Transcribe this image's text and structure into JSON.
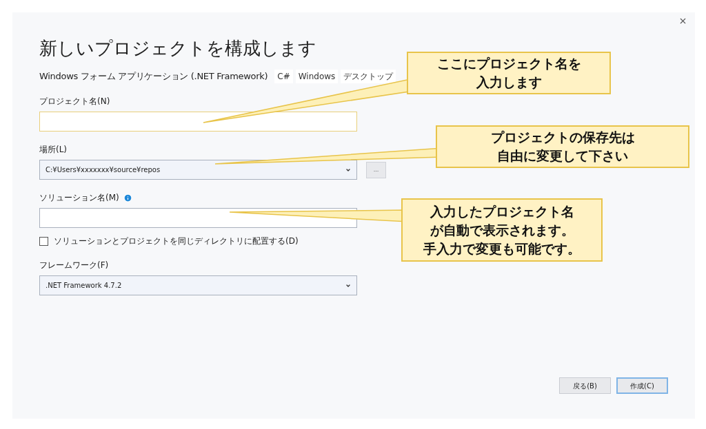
{
  "dialog": {
    "title": "新しいプロジェクトを構成します",
    "template": "Windows フォーム アプリケーション (.NET Framework)",
    "tags": [
      "C#",
      "Windows",
      "デスクトップ"
    ]
  },
  "fields": [
    {
      "kind": "text",
      "label": "プロジェクト名(N)",
      "focused": true,
      "info": false
    },
    {
      "kind": "dropdown",
      "label": "場所(L)",
      "value": "C:¥Users¥xxxxxxx¥source¥repos",
      "focused": false,
      "info": false,
      "browse": "..."
    },
    {
      "kind": "text",
      "label": "ソリューション名(M)",
      "focused": false,
      "info": true
    },
    {
      "kind": "checkbox",
      "label": "ソリューションとプロジェクトを同じディレクトリに配置する(D)",
      "checked": false
    },
    {
      "kind": "dropdown",
      "label": "フレームワーク(F)",
      "value": ".NET Framework 4.7.2",
      "focused": false,
      "info": false
    }
  ],
  "buttons": [
    {
      "label": "戻る(B)",
      "default": false
    },
    {
      "label": "作成(C)",
      "default": true
    }
  ],
  "callouts": [
    {
      "lines": [
        "ここにプロジェクト名を",
        "入力します"
      ]
    },
    {
      "lines": [
        "プロジェクトの保存先は",
        "自由に変更して下さい"
      ]
    },
    {
      "lines": [
        "入力したプロジェクト名",
        "が自動で表示されます。",
        "手入力で変更も可能です。"
      ]
    }
  ]
}
